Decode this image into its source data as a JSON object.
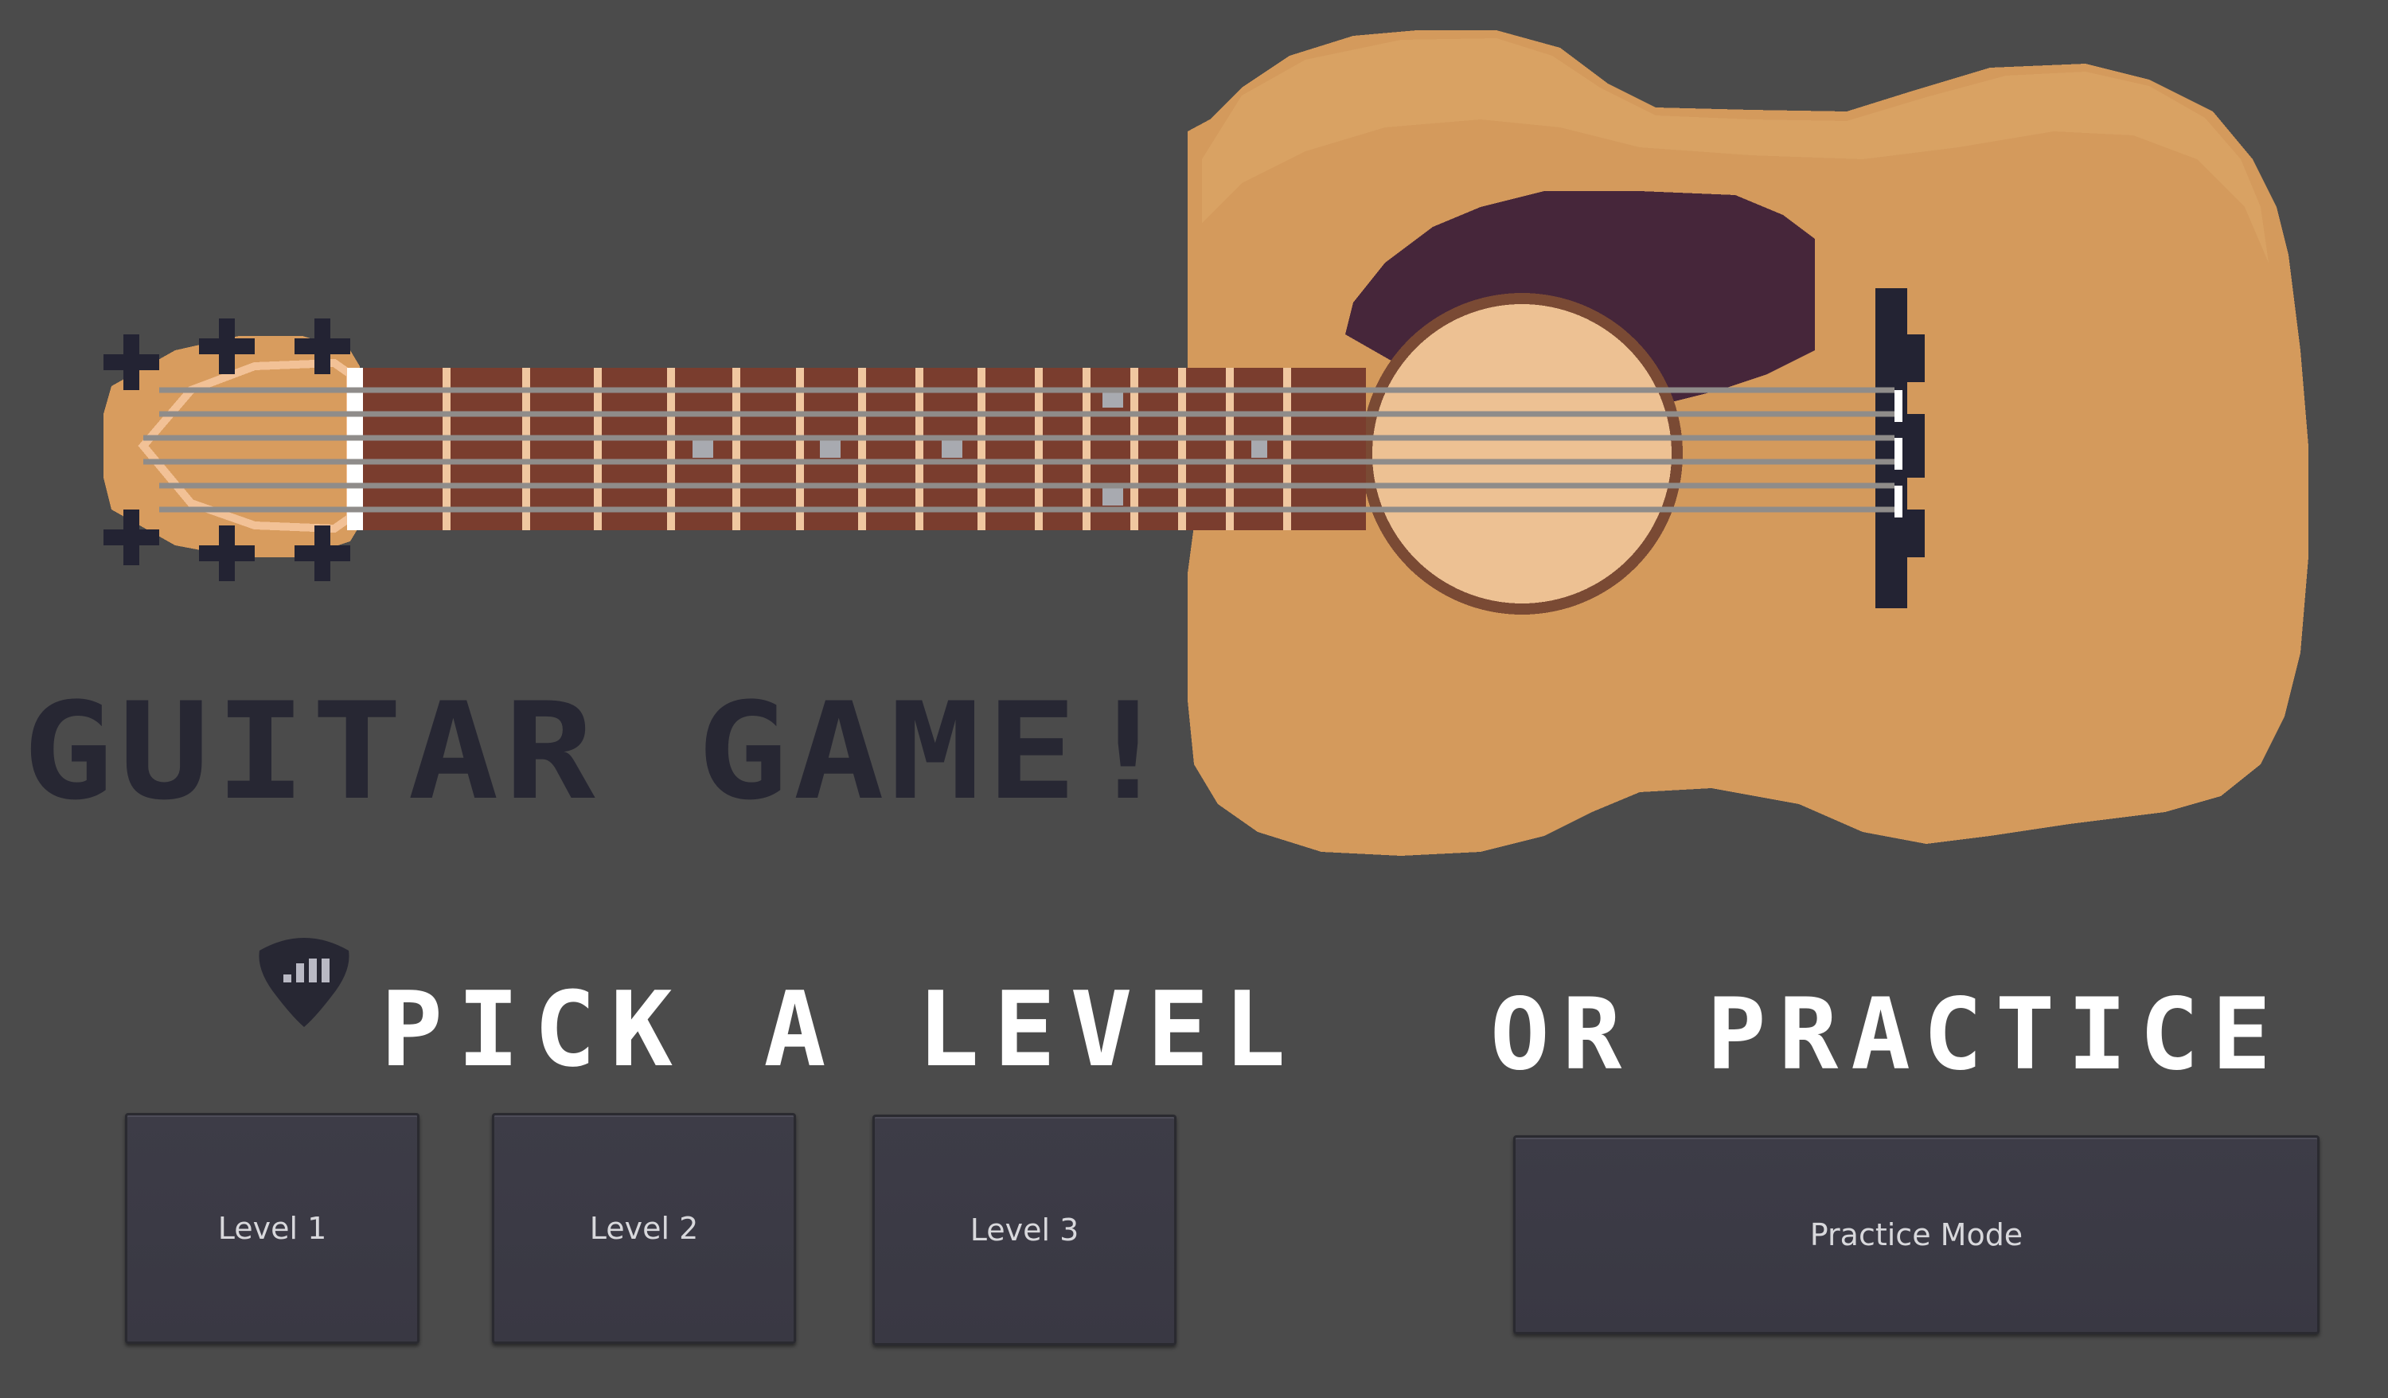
{
  "title": "GUITAR GAME!",
  "pick_heading": "PICK A LEVEL",
  "practice_heading": "OR PRACTICE",
  "buttons": {
    "level_1": "Level 1",
    "level_2": "Level 2",
    "level_3": "Level 3",
    "practice": "Practice Mode"
  },
  "icons": {
    "guitar": "acoustic-guitar-icon",
    "pick": "guitar-pick-signal-icon"
  },
  "colors": {
    "background": "#4b4b4b",
    "title_text": "#272733",
    "heading_text": "#ffffff",
    "button_fill": "#3b3a45",
    "button_text": "#d8d8dc",
    "guitar_body": "#d49a5c",
    "fretboard": "#7a3d2e",
    "soundhole": "#edc193",
    "pickguard": "#46263a"
  }
}
